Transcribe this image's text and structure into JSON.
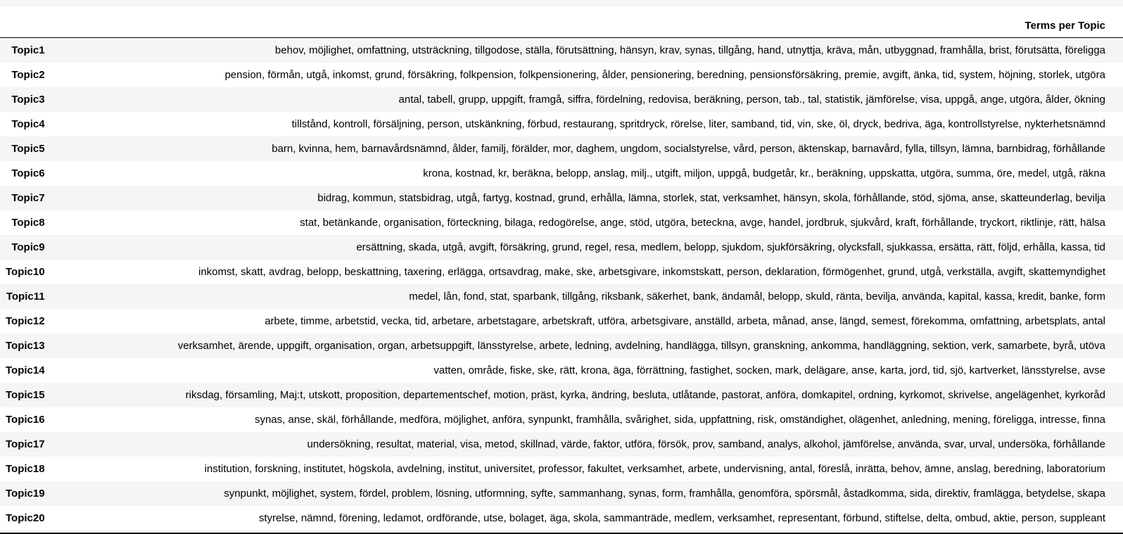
{
  "table": {
    "column_header": "Terms per Topic",
    "rows": [
      {
        "label": "Topic1",
        "terms": "behov, möjlighet, omfattning, utsträckning, tillgodose, ställa, förutsättning, hänsyn, krav, synas, tillgång, hand, utnyttja, kräva, mån, utbyggnad, framhålla, brist, förutsätta, föreligga"
      },
      {
        "label": "Topic2",
        "terms": "pension, förmån, utgå, inkomst, grund, försäkring, folkpension, folkpensionering, ålder, pensionering, beredning, pensionsförsäkring, premie, avgift, änka, tid, system, höjning, storlek, utgöra"
      },
      {
        "label": "Topic3",
        "terms": "antal, tabell, grupp, uppgift, framgå, siffra, fördelning, redovisa, beräkning, person, tab., tal, statistik, jämförelse, visa, uppgå, ange, utgöra, ålder, ökning"
      },
      {
        "label": "Topic4",
        "terms": "tillstånd, kontroll, försäljning, person, utskänkning, förbud, restaurang, spritdryck, rörelse, liter, samband, tid, vin, ske, öl, dryck, bedriva, äga, kontrollstyrelse, nykterhetsnämnd"
      },
      {
        "label": "Topic5",
        "terms": "barn, kvinna, hem, barnavårdsnämnd, ålder, familj, förälder, mor, daghem, ungdom, socialstyrelse, vård, person, äktenskap, barnavård, fylla, tillsyn, lämna, barnbidrag, förhållande"
      },
      {
        "label": "Topic6",
        "terms": "krona, kostnad, kr, beräkna, belopp, anslag, milj., utgift, miljon, uppgå, budgetår, kr., beräkning, uppskatta, utgöra, summa, öre, medel, utgå, räkna"
      },
      {
        "label": "Topic7",
        "terms": "bidrag, kommun, statsbidrag, utgå, fartyg, kostnad, grund, erhålla, lämna, storlek, stat, verksamhet, hänsyn, skola, förhållande, stöd, sjöma, anse, skatteunderlag, bevilja"
      },
      {
        "label": "Topic8",
        "terms": "stat, betänkande, organisation, förteckning, bilaga, redogörelse, ange, stöd, utgöra, beteckna, avge, handel, jordbruk, sjukvård, kraft, förhållande, tryckort, riktlinje, rätt, hälsa"
      },
      {
        "label": "Topic9",
        "terms": "ersättning, skada, utgå, avgift, försäkring, grund, regel, resa, medlem, belopp, sjukdom, sjukförsäkring, olycksfall, sjukkassa, ersätta, rätt, följd, erhålla, kassa, tid"
      },
      {
        "label": "Topic10",
        "terms": "inkomst, skatt, avdrag, belopp, beskattning, taxering, erlägga, ortsavdrag, make, ske, arbetsgivare, inkomstskatt, person, deklaration, förmögenhet, grund, utgå, verkställa, avgift, skattemyndighet"
      },
      {
        "label": "Topic11",
        "terms": "medel, lån, fond, stat, sparbank, tillgång, riksbank, säkerhet, bank, ändamål, belopp, skuld, ränta, bevilja, använda, kapital, kassa, kredit, banke, form"
      },
      {
        "label": "Topic12",
        "terms": "arbete, timme, arbetstid, vecka, tid, arbetare, arbetstagare, arbetskraft, utföra, arbetsgivare, anställd, arbeta, månad, anse, längd, semest, förekomma, omfattning, arbetsplats, antal"
      },
      {
        "label": "Topic13",
        "terms": "verksamhet, ärende, uppgift, organisation, organ, arbetsuppgift, länsstyrelse, arbete, ledning, avdelning, handlägga, tillsyn, granskning, ankomma, handläggning, sektion, verk, samarbete, byrå, utöva"
      },
      {
        "label": "Topic14",
        "terms": "vatten, område, fiske, ske, rätt, krona, äga, förrättning, fastighet, socken, mark, delägare, anse, karta, jord, tid, sjö, kartverket, länsstyrelse, avse"
      },
      {
        "label": "Topic15",
        "terms": "riksdag, församling, Maj:t, utskott, proposition, departementschef, motion, präst, kyrka, ändring, besluta, utlåtande, pastorat, anföra, domkapitel, ordning, kyrkomot, skrivelse, angelägenhet, kyrkoråd"
      },
      {
        "label": "Topic16",
        "terms": "synas, anse, skäl, förhållande, medföra, möjlighet, anföra, synpunkt, framhålla, svårighet, sida, uppfattning, risk, omständighet, olägenhet, anledning, mening, föreligga, intresse, finna"
      },
      {
        "label": "Topic17",
        "terms": "undersökning, resultat, material, visa, metod, skillnad, värde, faktor, utföra, försök, prov, samband, analys, alkohol, jämförelse, använda, svar, urval, undersöka, förhållande"
      },
      {
        "label": "Topic18",
        "terms": "institution, forskning, institutet, högskola, avdelning, institut, universitet, professor, fakultet, verksamhet, arbete, undervisning, antal, föreslå, inrätta, behov, ämne, anslag, beredning, laboratorium"
      },
      {
        "label": "Topic19",
        "terms": "synpunkt, möjlighet, system, fördel, problem, lösning, utformning, syfte, sammanhang, synas, form, framhålla, genomföra, spörsmål, åstadkomma, sida, direktiv, framlägga, betydelse, skapa"
      },
      {
        "label": "Topic20",
        "terms": "styrelse, nämnd, förening, ledamot, ordförande, utse, bolaget, äga, skola, sammanträde, medlem, verksamhet, representant, förbund, stiftelse, delta, ombud, aktie, person, suppleant"
      }
    ]
  }
}
